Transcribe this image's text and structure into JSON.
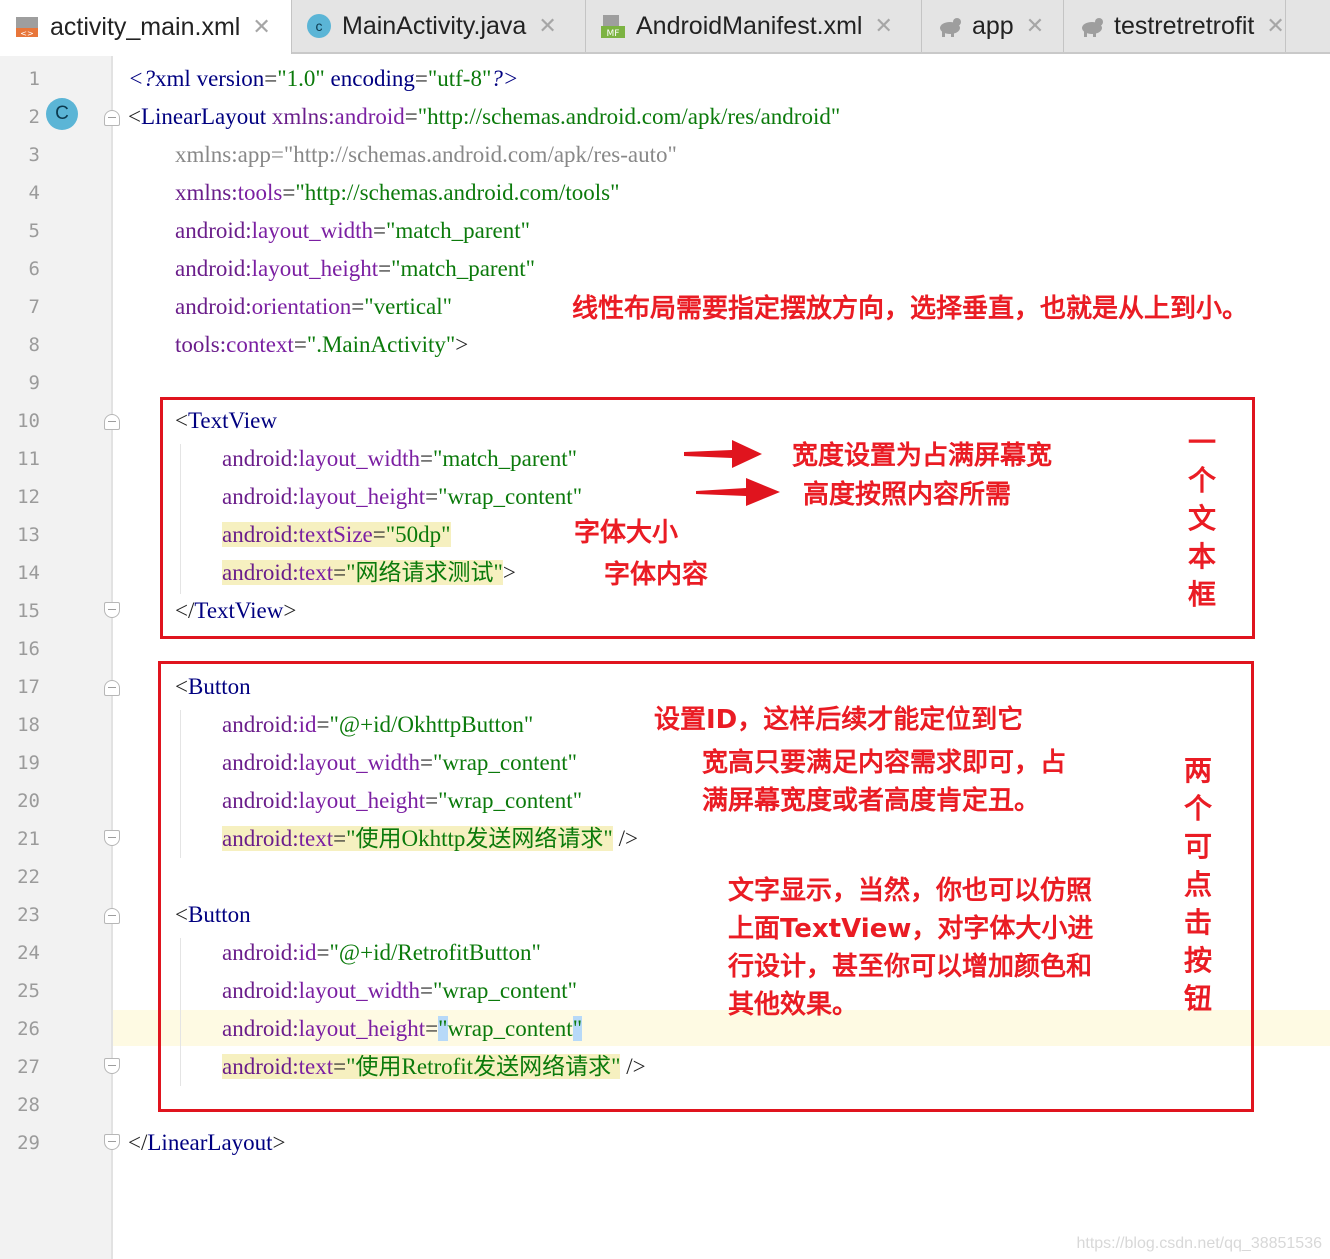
{
  "tabs": [
    {
      "label": "activity_main.xml",
      "icon": "xml-layout-icon",
      "active": true
    },
    {
      "label": "MainActivity.java",
      "icon": "java-class-icon",
      "active": false
    },
    {
      "label": "AndroidManifest.xml",
      "icon": "manifest-icon",
      "active": false
    },
    {
      "label": "app",
      "icon": "gradle-icon",
      "active": false
    },
    {
      "label": "testretretrofit",
      "icon": "gradle-icon",
      "active": false
    }
  ],
  "close_glyph": "✕",
  "gutter": {
    "line_numbers": [
      "1",
      "2",
      "3",
      "4",
      "5",
      "6",
      "7",
      "8",
      "9",
      "10",
      "11",
      "12",
      "13",
      "14",
      "15",
      "16",
      "17",
      "18",
      "19",
      "20",
      "21",
      "22",
      "23",
      "24",
      "25",
      "26",
      "27",
      "28",
      "29"
    ],
    "class_badge": "C",
    "mf_badge": "MF"
  },
  "code": {
    "l1": {
      "p1": "<?",
      "t": "xml",
      "a1": " version",
      "eq1": "=",
      "v1": "\"1.0\"",
      "a2": " encoding",
      "eq2": "=",
      "v2": "\"utf-8\"",
      "p2": "?>"
    },
    "l2": {
      "p1": "<",
      "t": "LinearLayout",
      "ns": " xmlns:",
      "a": "android",
      "eq": "=",
      "v": "\"http://schemas.android.com/apk/res/android\""
    },
    "l3": {
      "ns": "xmlns:",
      "a": "app",
      "eq": "=",
      "v": "\"http://schemas.android.com/apk/res-auto\""
    },
    "l4": {
      "ns": "xmlns:",
      "a": "tools",
      "eq": "=",
      "v": "\"http://schemas.android.com/tools\""
    },
    "l5": {
      "ns": "android:",
      "a": "layout_width",
      "eq": "=",
      "v": "\"match_parent\""
    },
    "l6": {
      "ns": "android:",
      "a": "layout_height",
      "eq": "=",
      "v": "\"match_parent\""
    },
    "l7": {
      "ns": "android:",
      "a": "orientation",
      "eq": "=",
      "v": "\"vertical\""
    },
    "l8": {
      "ns": "tools:",
      "a": "context",
      "eq": "=",
      "v": "\".MainActivity\"",
      "p": ">"
    },
    "l10": {
      "p": "<",
      "t": "TextView"
    },
    "l11": {
      "ns": "android:",
      "a": "layout_width",
      "eq": "=",
      "v": "\"match_parent\""
    },
    "l12": {
      "ns": "android:",
      "a": "layout_height",
      "eq": "=",
      "v": "\"wrap_content\""
    },
    "l13": {
      "ns": "android:",
      "a": "textSize",
      "eq": "=",
      "v": "\"50dp\""
    },
    "l14": {
      "ns": "android:",
      "a": "text",
      "eq": "=",
      "v": "\"网络请求测试\"",
      "p": ">"
    },
    "l15": {
      "p1": "</",
      "t": "TextView",
      "p2": ">"
    },
    "l17": {
      "p": "<",
      "t": "Button"
    },
    "l18": {
      "ns": "android:",
      "a": "id",
      "eq": "=",
      "v": "\"@+id/OkhttpButton\""
    },
    "l19": {
      "ns": "android:",
      "a": "layout_width",
      "eq": "=",
      "v": "\"wrap_content\""
    },
    "l20": {
      "ns": "android:",
      "a": "layout_height",
      "eq": "=",
      "v": "\"wrap_content\""
    },
    "l21": {
      "ns": "android:",
      "a": "text",
      "eq": "=",
      "v": "\"使用Okhttp发送网络请求\"",
      "p": " />"
    },
    "l23": {
      "p": "<",
      "t": "Button"
    },
    "l24": {
      "ns": "android:",
      "a": "id",
      "eq": "=",
      "v": "\"@+id/RetrofitButton\""
    },
    "l25": {
      "ns": "android:",
      "a": "layout_width",
      "eq": "=",
      "v": "\"wrap_content\""
    },
    "l26": {
      "ns": "android:",
      "a": "layout_height",
      "eq": "=",
      "q1": "\"",
      "v": "wrap_content",
      "q2": "\""
    },
    "l27": {
      "ns": "android:",
      "a": "text",
      "eq": "=",
      "v": "\"使用Retrofit发送网络请求\"",
      "p": " />"
    },
    "l29": {
      "p1": "</",
      "t": "LinearLayout",
      "p2": ">"
    }
  },
  "annotations": {
    "orientation_note": "线性布局需要指定摆放方向，选择垂直，也就是从上到小。",
    "width_note": "宽度设置为占满屏幕宽",
    "height_note": "高度按照内容所需",
    "textsize_note": "字体大小",
    "text_note": "字体内容",
    "textbox_label": "一个文本框",
    "id_note": "设置ID，这样后续才能定位到它",
    "wrap_note_1": "宽高只要满足内容需求即可，占",
    "wrap_note_2": "满屏幕宽度或者高度肯定丑。",
    "text_display_note_1": "文字显示，当然，你也可以仿照",
    "text_display_note_2": "上面TextView，对字体大小进",
    "text_display_note_3": "行设计，甚至你可以增加颜色和",
    "text_display_note_4": "其他效果。",
    "buttons_label": "两个可点击按钮"
  },
  "colors": {
    "annotation_red": "#e0141e",
    "tag_blue": "#000080",
    "attr_purple": "#7b1fa2",
    "value_green": "#0b7a0b",
    "highlight_yellow": "#f6f0c0"
  },
  "watermark": "https://blog.csdn.net/qq_38851536"
}
